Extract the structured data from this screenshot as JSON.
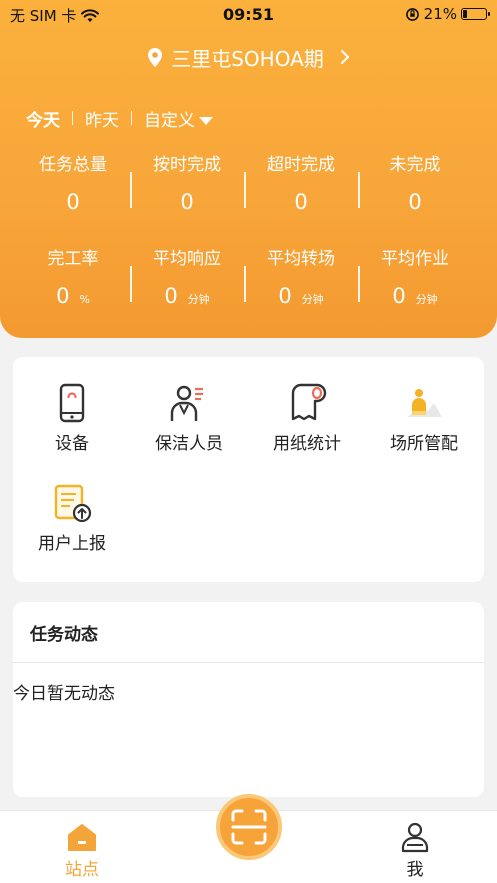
{
  "status_bar": {
    "carrier": "无 SIM 卡",
    "time": "09:51",
    "battery_percent": "21%",
    "battery_level": 0.21
  },
  "header": {
    "location": "三里屯SOHOA期",
    "date_tabs": [
      "今天",
      "昨天",
      "自定义"
    ],
    "active_tab": "今天"
  },
  "stats": {
    "row1": [
      {
        "label": "任务总量",
        "value": "0"
      },
      {
        "label": "按时完成",
        "value": "0"
      },
      {
        "label": "超时完成",
        "value": "0"
      },
      {
        "label": "未完成",
        "value": "0"
      }
    ],
    "row2": [
      {
        "label": "完工率",
        "value": "0",
        "unit": "%"
      },
      {
        "label": "平均响应",
        "value": "0",
        "unit": "分钟"
      },
      {
        "label": "平均转场",
        "value": "0",
        "unit": "分钟"
      },
      {
        "label": "平均作业",
        "value": "0",
        "unit": "分钟"
      }
    ]
  },
  "menu": {
    "items": [
      {
        "label": "设备",
        "icon": "phone-device-icon"
      },
      {
        "label": "保洁人员",
        "icon": "cleaner-person-icon"
      },
      {
        "label": "用纸统计",
        "icon": "toilet-paper-icon"
      },
      {
        "label": "场所管配",
        "icon": "venue-manage-icon"
      },
      {
        "label": "用户上报",
        "icon": "user-report-icon"
      }
    ]
  },
  "feed": {
    "title": "任务动态",
    "empty_text": "今日暂无动态"
  },
  "tabbar": {
    "items": [
      {
        "label": "站点",
        "icon": "home-icon",
        "active": true
      },
      {
        "label": "我",
        "icon": "user-icon",
        "active": false
      }
    ],
    "center": {
      "icon": "scan-icon"
    }
  },
  "colors": {
    "accent": "#f8a63a",
    "accent_light": "#fbc877",
    "background": "#f2f2f2"
  }
}
